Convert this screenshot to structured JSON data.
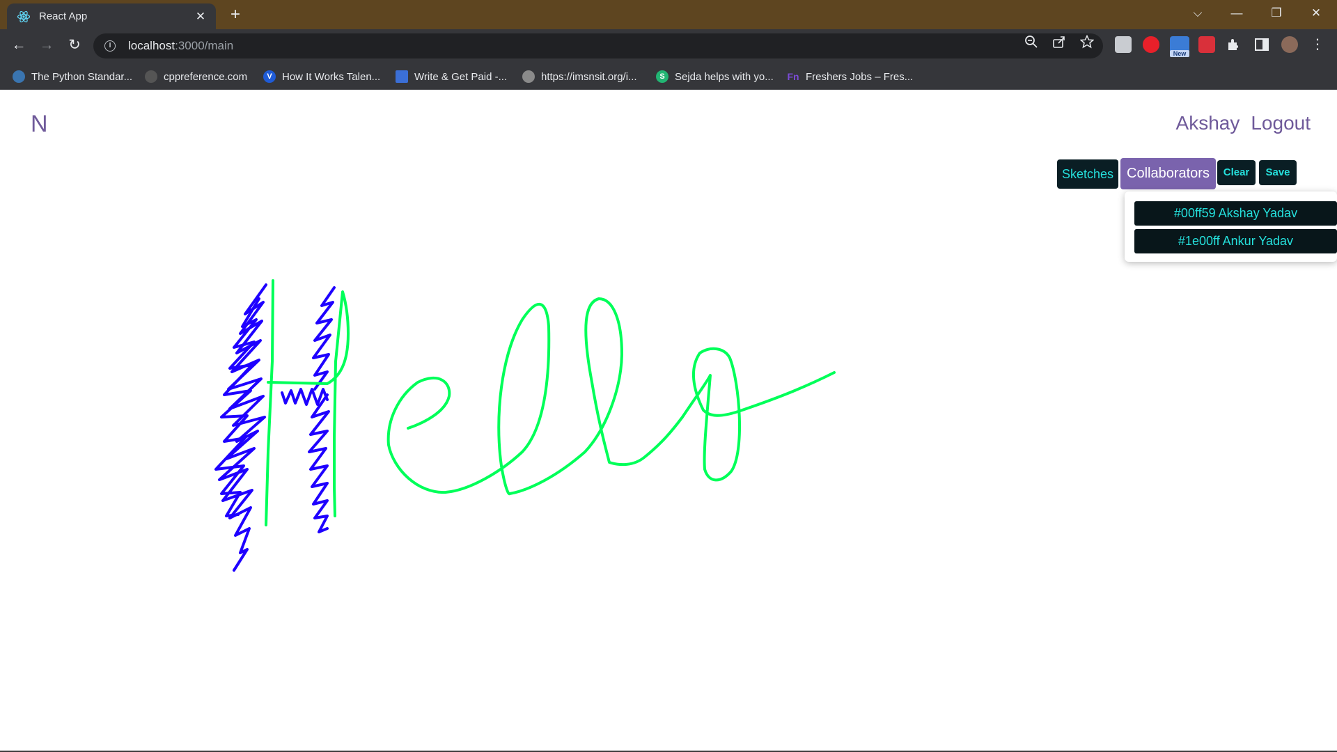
{
  "browser": {
    "tab_title": "React App",
    "tab_close": "✕",
    "new_tab": "+",
    "url_host": "localhost",
    "url_rest": ":3000/main",
    "controls": {
      "dropdown": "⌵",
      "minimize": "—",
      "restore": "❐",
      "close": "✕"
    },
    "nav": {
      "back": "←",
      "forward": "→",
      "reload": "↻"
    },
    "extension_badge": "New"
  },
  "bookmarks": [
    {
      "label": "The Python Standar...",
      "icon": "python-icon",
      "color": "#3a75b0"
    },
    {
      "label": "cppreference.com",
      "icon": "cppreference-icon",
      "color": "#555555"
    },
    {
      "label": "How It Works Talen...",
      "icon": "v-icon",
      "color": "#1f5bd6"
    },
    {
      "label": "Write & Get Paid -...",
      "icon": "book-icon",
      "color": "#3b6fd6"
    },
    {
      "label": "https://imsnsit.org/i...",
      "icon": "globe-icon",
      "color": "#8a8a8a"
    },
    {
      "label": "Sejda helps with yo...",
      "icon": "sejda-icon",
      "color": "#22b573"
    },
    {
      "label": "Freshers Jobs – Fres...",
      "icon": "fn-icon",
      "color": "#7a4bd6"
    }
  ],
  "app": {
    "brand": "N",
    "user": "Akshay",
    "logout": "Logout",
    "buttons": {
      "sketches": "Sketches",
      "collaborators": "Collaborators",
      "clear": "Clear",
      "save": "Save"
    },
    "collaborators": [
      {
        "label": "#00ff59 Akshay Yadav",
        "color": "#00ff59"
      },
      {
        "label": "#1e00ff Ankur Yadav",
        "color": "#1e00ff"
      }
    ]
  },
  "colors": {
    "accent_purple": "#7a63ad",
    "button_dark": "#0a1e24",
    "button_text": "#25e0dc",
    "stroke_green": "#00ff59",
    "stroke_blue": "#1e00ff"
  }
}
